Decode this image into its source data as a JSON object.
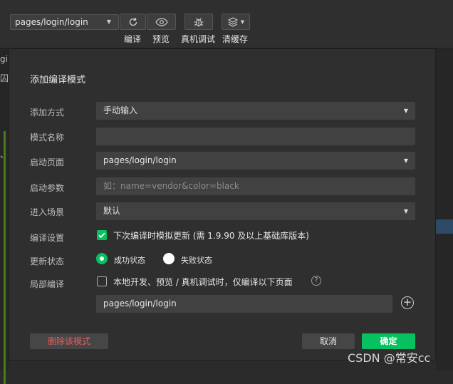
{
  "toolbar": {
    "page_path": "pages/login/login",
    "buttons": [
      {
        "label": "编译",
        "icon": "refresh-icon"
      },
      {
        "label": "预览",
        "icon": "eye-icon"
      },
      {
        "label": "真机调试",
        "icon": "bug-icon"
      },
      {
        "label": "清缓存",
        "icon": "layers-icon"
      }
    ]
  },
  "background": {
    "left_glyphs": [
      "gi",
      "囚",
      "、"
    ]
  },
  "dialog": {
    "title": "添加编译模式",
    "add_method": {
      "label": "添加方式",
      "value": "手动输入"
    },
    "mode_name": {
      "label": "模式名称",
      "value": ""
    },
    "launch_page": {
      "label": "启动页面",
      "value": "pages/login/login"
    },
    "launch_params": {
      "label": "启动参数",
      "placeholder": "如：name=vendor&color=black"
    },
    "scene": {
      "label": "进入场景",
      "value": "默认"
    },
    "compile_settings": {
      "label": "编译设置",
      "option": "下次编译时模拟更新 (需 1.9.90 及以上基础库版本)",
      "checked": true
    },
    "update_state": {
      "label": "更新状态",
      "success": "成功状态",
      "fail": "失败状态",
      "selected": "成功状态"
    },
    "partial_compile": {
      "label": "局部编译",
      "option": "本地开发、预览 / 真机调试时，仅编译以下页面",
      "checked": false,
      "page": "pages/login/login"
    },
    "delete_label": "删除该模式",
    "cancel_label": "取消",
    "ok_label": "确定"
  },
  "watermark": "CSDN @常安cc",
  "colors": {
    "accent": "#07c160",
    "danger": "#e06060",
    "bg": "#2f2f2f",
    "field": "#414141"
  }
}
